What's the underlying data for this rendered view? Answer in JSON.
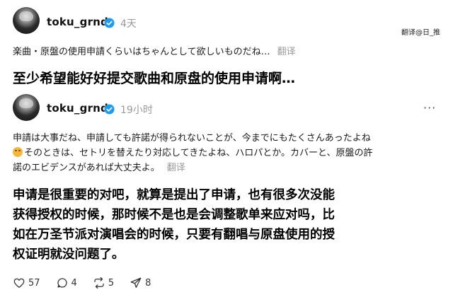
{
  "post1": {
    "handle": "toku_grnd",
    "time": "4天",
    "text": "楽曲・原盤の使用申請くらいはちゃんとして欲しいものだね…",
    "translate_label": "翻译",
    "translation": "至少希望能好好提交歌曲和原盘的使用申请啊…"
  },
  "watermark": "翻译@日_推",
  "post2": {
    "handle": "toku_grnd",
    "time": "19小时",
    "more": "···",
    "text_line1": "申請は大事だね、申請しても許諾が得られないことが、今までにもたくさんあったよね",
    "text_line2": "そのときは、セトリを替えたり対応してきたよね、ハロパとか。カバーと、原盤の許",
    "text_line3": "諾のエビデンスがあれば大丈夫よ。",
    "translate_label": "翻译",
    "translation_line1": "申请是很重要的对吧，就算是提出了申请，也有很多次没能",
    "translation_line2": "获得授权的时候，那时候不是也是会调整歌单来应对吗，比",
    "translation_line3": "如在万圣节派对演唱会的时候，只要有翻唱与原盘使用的授",
    "translation_line4": "权证明就没问题了。"
  },
  "actions": {
    "likes": "57",
    "replies": "4",
    "reposts": "5",
    "shares": "8"
  },
  "colors": {
    "verified": "#1d9bf0",
    "muted": "#9a9a9a"
  }
}
